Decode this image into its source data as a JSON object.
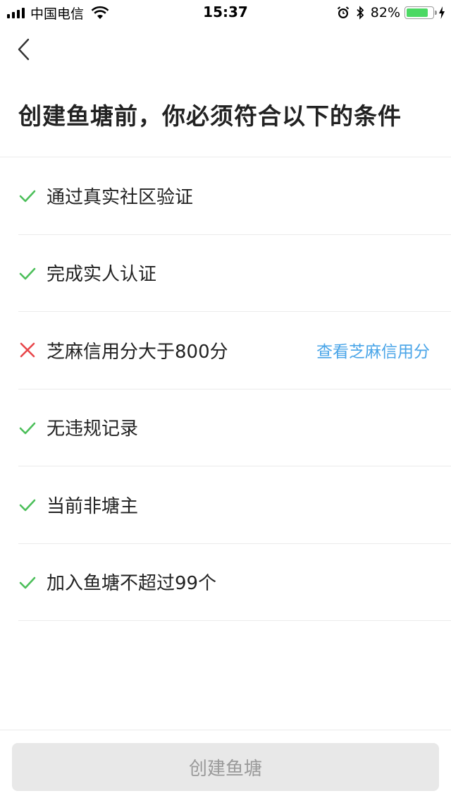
{
  "status_bar": {
    "carrier": "中国电信",
    "time": "15:37",
    "battery_percent": "82%",
    "battery_level": 0.82,
    "icons": [
      "signal-icon",
      "wifi-icon",
      "alarm-icon",
      "bluetooth-icon",
      "battery-icon",
      "charging-icon"
    ]
  },
  "nav": {
    "back_icon": "chevron-left-icon"
  },
  "page": {
    "title": "创建鱼塘前，你必须符合以下的条件"
  },
  "conditions": [
    {
      "label": "通过真实社区验证",
      "status": "pass"
    },
    {
      "label": "完成实人认证",
      "status": "pass"
    },
    {
      "label": "芝麻信用分大于800分",
      "status": "fail",
      "link": "查看芝麻信用分"
    },
    {
      "label": "无违规记录",
      "status": "pass"
    },
    {
      "label": "当前非塘主",
      "status": "pass"
    },
    {
      "label": "加入鱼塘不超过99个",
      "status": "pass"
    }
  ],
  "colors": {
    "pass": "#4cbf5a",
    "fail": "#e8464a",
    "link": "#4aa5e8",
    "button_bg": "#e8e8e8",
    "button_text": "#9a9a9a"
  },
  "footer": {
    "create_button": "创建鱼塘"
  }
}
